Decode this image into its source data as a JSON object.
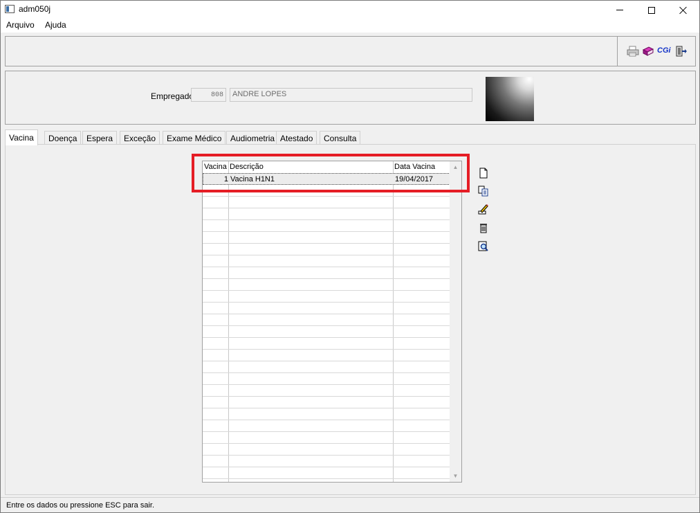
{
  "window": {
    "title": "adm050j"
  },
  "menu": {
    "items": [
      {
        "label": "Arquivo"
      },
      {
        "label": "Ajuda"
      }
    ]
  },
  "toolbar": {
    "icons": [
      "printer-icon",
      "book-icon",
      "cgi-icon",
      "exit-icon"
    ],
    "cgi_label": "CGi"
  },
  "employee": {
    "label": "Empregado:",
    "code": "808",
    "name": "ANDRE LOPES"
  },
  "tabs": [
    {
      "label": "Vacina",
      "active": true
    },
    {
      "label": "Doença"
    },
    {
      "label": "Espera"
    },
    {
      "label": "Exceção"
    },
    {
      "label": "Exame Médico"
    },
    {
      "label": "Audiometria"
    },
    {
      "label": "Atestado"
    },
    {
      "label": "Consulta"
    }
  ],
  "grid": {
    "columns": [
      "Vacina",
      "Descrição",
      "Data Vacina"
    ],
    "rows": [
      {
        "vacina": "1",
        "descricao": "Vacina H1N1",
        "data": "19/04/2017"
      }
    ]
  },
  "side_actions": [
    "new-icon",
    "copy-icon",
    "edit-icon",
    "delete-icon",
    "search-icon"
  ],
  "status": {
    "text": "Entre os dados ou pressione ESC para sair."
  },
  "colors": {
    "highlight": "#e51d25",
    "cgi": "#1535c8"
  }
}
